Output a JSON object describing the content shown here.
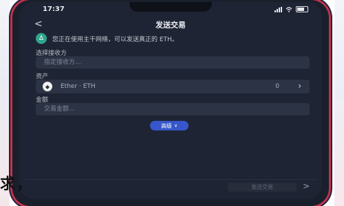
{
  "status_bar": {
    "time": "17:37"
  },
  "nav": {
    "title": "发送交易",
    "back_glyph": "<"
  },
  "notice": {
    "badge_icon": "ethereum-badge-icon",
    "badge_glyph": "Δ",
    "text": "您正在使用主干网络，可以发送真正的 ETH。"
  },
  "recipient": {
    "label": "选择接收方",
    "placeholder": "指定接收方..."
  },
  "asset": {
    "label": "资产",
    "name": "Ether · ETH",
    "balance": "0",
    "coin_icon": "ether-coin-icon"
  },
  "amount": {
    "label": "金额",
    "placeholder": "交易金额..."
  },
  "advanced": {
    "label": "高级"
  },
  "footer": {
    "next_label": "发送交易",
    "arrow": ">"
  },
  "overlay": {
    "text": "求，"
  },
  "colors": {
    "screen_bg": "#1e2433",
    "field_bg": "#2c3344",
    "accent_blue": "#3656c9",
    "eth_green": "#2fa58c",
    "frame_red": "#c2334a"
  }
}
